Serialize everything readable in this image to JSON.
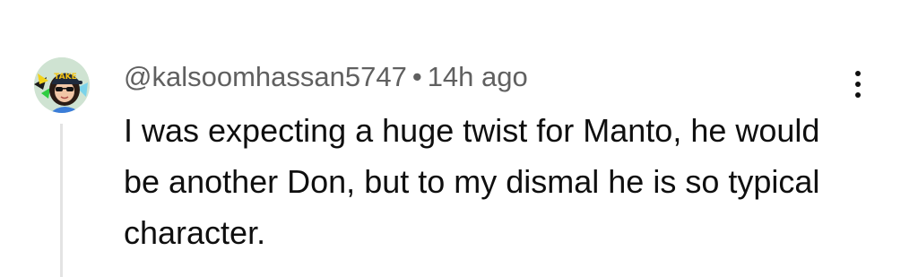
{
  "comment": {
    "author_handle": "@kalsoomhassan5747",
    "separator": "•",
    "timestamp": "14h ago",
    "text": "I was expecting a huge twist for Manto, he would be another Don, but to my dismal he is so typical character.",
    "avatar_cap_text": "TAKE"
  },
  "icons": {
    "more": "more-vertical-icon"
  }
}
